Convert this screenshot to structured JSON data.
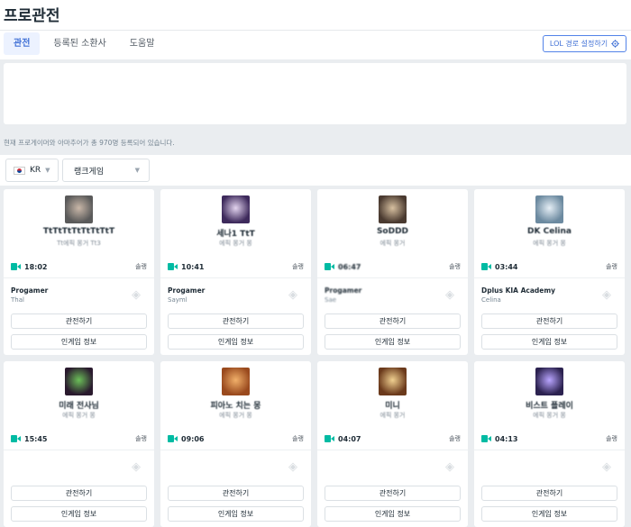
{
  "header": {
    "title": "프로관전"
  },
  "tabs": [
    {
      "label": "관전",
      "active": true
    },
    {
      "label": "등록된 소환사",
      "active": false
    },
    {
      "label": "도움말",
      "active": false
    }
  ],
  "settings_button": {
    "label": "LOL 경로 설정하기",
    "icon": "gear-icon"
  },
  "info_text": "현재 프로게이머와 아마추어가 총 970명 등록되어 있습니다.",
  "filters": {
    "region": "KR",
    "queue": "랭크게임"
  },
  "colors": {
    "accent": "#4171d6",
    "live": "#00bba3"
  },
  "cards": [
    {
      "nick": "TtTtTtTtTtTtTtT",
      "sub": "Tt에픽 몽거 Tt3",
      "time": "18:02",
      "tier": "솔랭",
      "team": "Progamer",
      "player": "Thal",
      "watch": "관전하기",
      "info": "인게임 정보",
      "avatar_color": "#5a5a5a",
      "avatar_hi": "#c9b7a8"
    },
    {
      "nick": "세나1 TtT",
      "sub": "에픽 몽거 몽",
      "time": "10:41",
      "tier": "솔랭",
      "team": "Progamer",
      "player": "Sayml",
      "watch": "관전하기",
      "info": "인게임 정보",
      "avatar_color": "#3e2a5c",
      "avatar_hi": "#e3d4ef"
    },
    {
      "nick": "SoDDD",
      "sub": "에픽 몽거",
      "time": "06:47",
      "tier": "솔랭",
      "team": "Progamer",
      "player": "Sae",
      "watch": "관전하기",
      "info": "인게임 정보",
      "avatar_color": "#4a3a30",
      "avatar_hi": "#d7c0a0"
    },
    {
      "nick": "DK Celina",
      "sub": "에픽 몽거 몽",
      "time": "03:44",
      "tier": "솔랭",
      "team": "Dplus KIA Academy",
      "player": "Celina",
      "watch": "관전하기",
      "info": "인게임 정보",
      "avatar_color": "#6c8aa0",
      "avatar_hi": "#e5eef5"
    },
    {
      "nick": "미래 전사님",
      "sub": "에픽 몽거 몽",
      "time": "15:45",
      "tier": "솔랭",
      "team": "",
      "player": "",
      "watch": "관전하기",
      "info": "인게임 정보",
      "avatar_color": "#2a1a2e",
      "avatar_hi": "#6bbf58"
    },
    {
      "nick": "피아노 치는 몽",
      "sub": "에픽 몽거 몽",
      "time": "09:06",
      "tier": "솔랭",
      "team": "",
      "player": "",
      "watch": "관전하기",
      "info": "인게임 정보",
      "avatar_color": "#9a4a1e",
      "avatar_hi": "#f1b06a"
    },
    {
      "nick": "미니",
      "sub": "에픽 몽거",
      "time": "04:07",
      "tier": "솔랭",
      "team": "",
      "player": "",
      "watch": "관전하기",
      "info": "인게임 정보",
      "avatar_color": "#6b3a1c",
      "avatar_hi": "#f0d090"
    },
    {
      "nick": "비스트 플레이",
      "sub": "에픽 몽거 몽",
      "time": "04:13",
      "tier": "솔랭",
      "team": "",
      "player": "",
      "watch": "관전하기",
      "info": "인게임 정보",
      "avatar_color": "#2c2250",
      "avatar_hi": "#b9a5ff"
    }
  ]
}
